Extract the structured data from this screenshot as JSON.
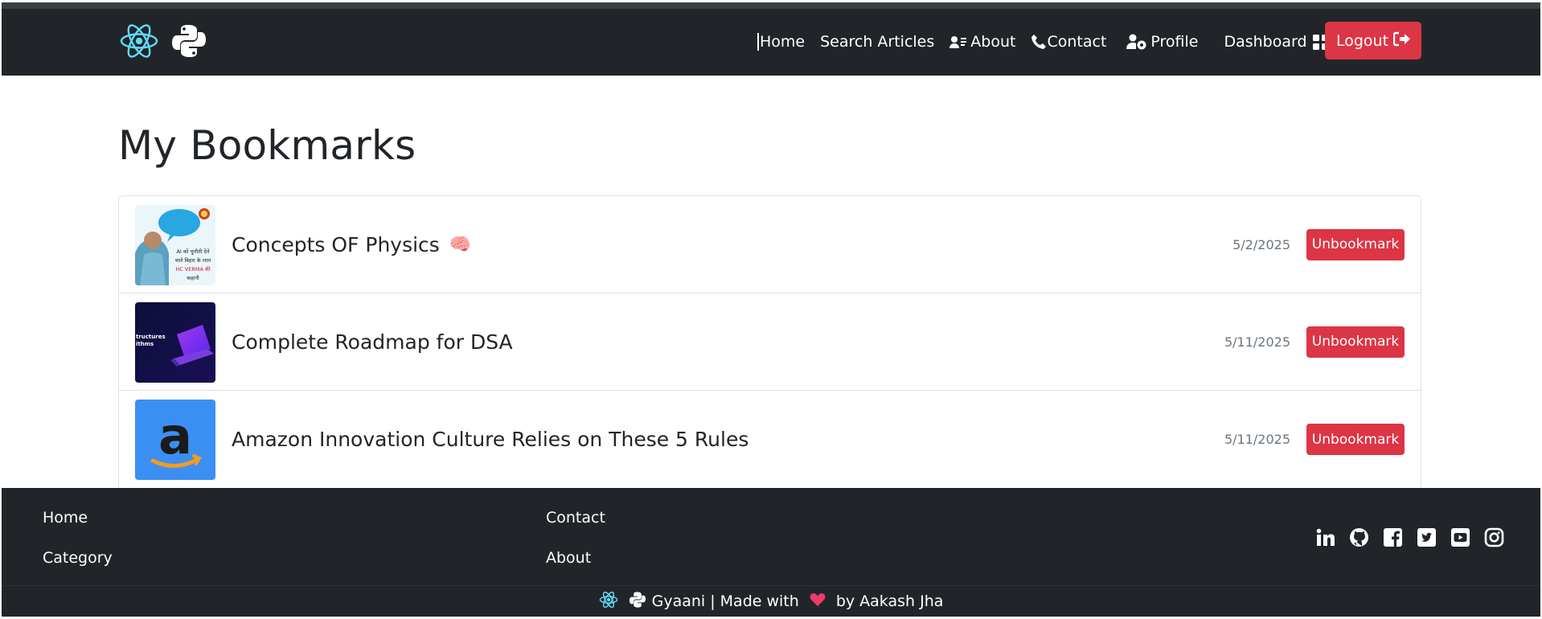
{
  "navbar": {
    "logos": [
      "atom-icon",
      "python-icon"
    ],
    "links": [
      {
        "label": "Home",
        "icon": ""
      },
      {
        "label": "Search Articles",
        "icon": ""
      },
      {
        "label": "About",
        "icon": "address-card-icon"
      },
      {
        "label": "Contact",
        "icon": "phone-icon"
      },
      {
        "label": "Profile",
        "icon": "user-gear-icon"
      },
      {
        "label": "Dashboard",
        "icon": "grid-icon"
      }
    ],
    "logout_label": "Logout",
    "logout_icon": "sign-out-icon",
    "accent": "#dc3545",
    "bg": "#212529"
  },
  "main": {
    "title": "My Bookmarks",
    "bookmarks": [
      {
        "title": "Concepts OF Physics",
        "emoji": "🧠",
        "date": "5/2/2025",
        "button": "Unbookmark",
        "thumb": "physics-teacher-thumbnail",
        "thumb_text": [
          "AI को चुनौती देने",
          "वाले बिहार के लाल",
          "HC VERMA की",
          "कहानी"
        ]
      },
      {
        "title": "Complete Roadmap for DSA",
        "emoji": "",
        "date": "5/11/2025",
        "button": "Unbookmark",
        "thumb": "dsa-laptop-thumbnail",
        "thumb_text": [
          "tructures",
          "ithms"
        ]
      },
      {
        "title": "Amazon Innovation Culture Relies on These 5 Rules",
        "emoji": "",
        "date": "5/11/2025",
        "button": "Unbookmark",
        "thumb": "amazon-logo-thumbnail",
        "thumb_text": [
          "a"
        ]
      }
    ]
  },
  "footer": {
    "col1": [
      "Home",
      "Category"
    ],
    "col2": [
      "Contact",
      "About"
    ],
    "socials": [
      "linkedin-icon",
      "github-icon",
      "facebook-icon",
      "twitter-icon",
      "youtube-icon",
      "instagram-icon"
    ],
    "credit_prefix": "Gyaani | Made with",
    "credit_suffix": "by Aakash Jha",
    "heart": "heart-icon"
  }
}
